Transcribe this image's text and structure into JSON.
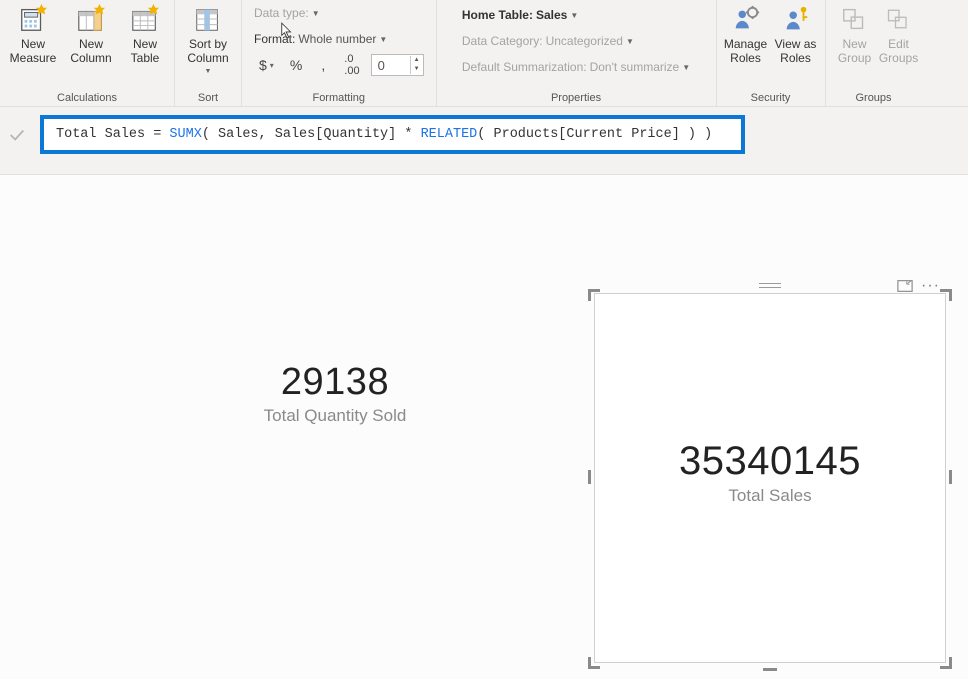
{
  "ribbon": {
    "groups": {
      "calculations": {
        "label": "Calculations",
        "new_measure": "New Measure",
        "new_column": "New Column",
        "new_table": "New Table"
      },
      "sort": {
        "label": "Sort",
        "sort_by_column": "Sort by Column"
      },
      "formatting": {
        "label": "Formatting",
        "data_type": "Data type:",
        "format": "Format:",
        "format_value": "Whole number",
        "currency_symbol": "$",
        "decimal_places": "0"
      },
      "properties": {
        "label": "Properties",
        "home_table": "Home Table:",
        "home_table_value": "Sales",
        "data_category": "Data Category:",
        "data_category_value": "Uncategorized",
        "default_summarization": "Default Summarization:",
        "default_summarization_value": "Don't summarize"
      },
      "security": {
        "label": "Security",
        "manage_roles": "Manage Roles",
        "view_as_roles": "View as Roles"
      },
      "groups": {
        "label": "Groups",
        "new_group": "New Group",
        "edit_groups": "Edit Groups"
      }
    }
  },
  "formula_bar": {
    "raw": "Total Sales = SUMX( Sales, Sales[Quantity] * RELATED( Products[Current Price] ) )",
    "parts": {
      "p1": "Total Sales = ",
      "fn1": "SUMX",
      "p2": "( Sales, Sales[Quantity] * ",
      "fn2": "RELATED",
      "p3": "( Products[Current Price] ) )"
    }
  },
  "canvas": {
    "card1": {
      "value": "29138",
      "label": "Total Quantity Sold"
    },
    "card2": {
      "value": "35340145",
      "label": "Total Sales"
    }
  }
}
